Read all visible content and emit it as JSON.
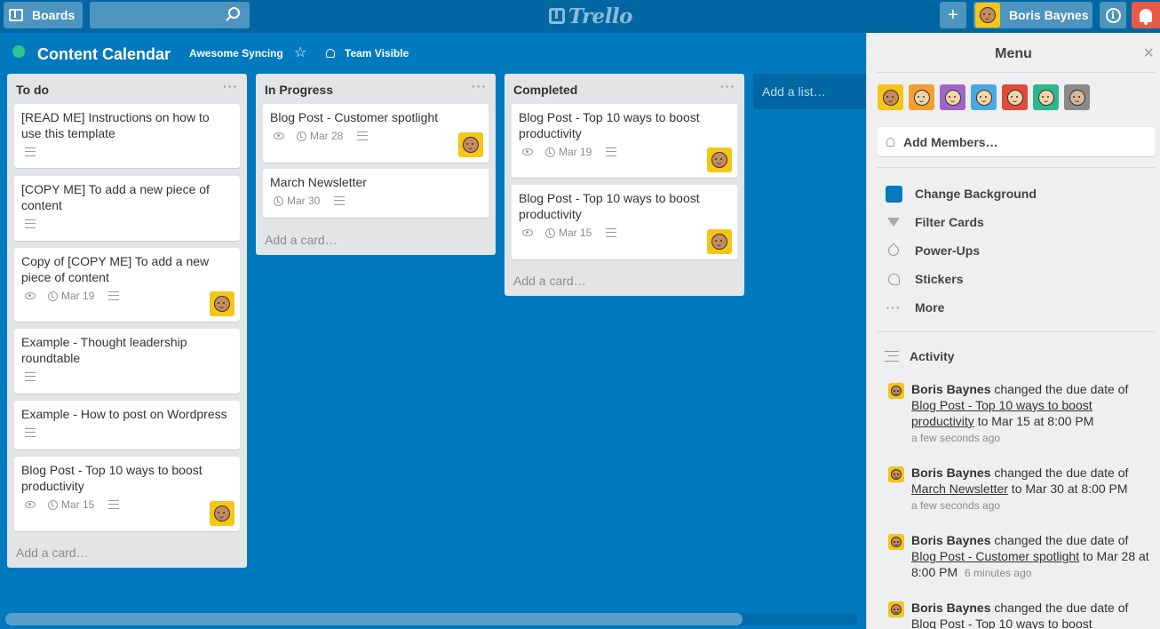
{
  "header": {
    "boards_label": "Boards",
    "search_placeholder": "",
    "logo_text": "Trello",
    "add_label": "+",
    "user_name": "Boris Baynes",
    "info_label": "i"
  },
  "board": {
    "title": "Content Calendar",
    "org": "Awesome Syncing",
    "star": "☆",
    "visibility": "Team Visible"
  },
  "lists": [
    {
      "title": "To do",
      "menu": "···",
      "cards": [
        {
          "title": "[READ ME] Instructions on how to use this template"
        },
        {
          "title": "[COPY ME] To add a new piece of content"
        },
        {
          "title": "Copy of [COPY ME] To add a new piece of content",
          "due": "Mar 19"
        },
        {
          "title": "Example - Thought leadership roundtable"
        },
        {
          "title": "Example - How to post on Wordpress"
        },
        {
          "title": "Blog Post - Top 10 ways to boost productivity",
          "due": "Mar 15"
        }
      ],
      "add_card": "Add a card…"
    },
    {
      "title": "In Progress",
      "menu": "···",
      "cards": [
        {
          "title": "Blog Post - Customer spotlight",
          "due": "Mar 28"
        },
        {
          "title": "March Newsletter",
          "due": "Mar 30"
        }
      ],
      "add_card": "Add a card…"
    },
    {
      "title": "Completed",
      "menu": "···",
      "cards": [
        {
          "title": "Blog Post - Top 10 ways to boost productivity",
          "due": "Mar 19"
        },
        {
          "title": "Blog Post - Top 10 ways to boost productivity",
          "due": "Mar 15"
        }
      ],
      "add_card": "Add a card…"
    }
  ],
  "add_list": "Add a list…",
  "sidebar": {
    "title": "Menu",
    "close": "×",
    "add_members": "Add Members…",
    "menu_items": [
      {
        "label": "Change Background",
        "icon": "background-swatch-icon"
      },
      {
        "label": "Filter Cards",
        "icon": "filter-icon"
      },
      {
        "label": "Power-Ups",
        "icon": "rocket-icon"
      },
      {
        "label": "Stickers",
        "icon": "sticker-icon"
      },
      {
        "label": "More",
        "icon": "more-dots-icon",
        "glyph": "···"
      }
    ],
    "activity_label": "Activity",
    "activity": [
      {
        "who": "Boris Baynes",
        "action": " changed the due date of ",
        "card": "Blog Post - Top 10 ways to boost productivity",
        "rest": " to Mar 15 at 8:00 PM",
        "when": "a few seconds ago"
      },
      {
        "who": "Boris Baynes",
        "action": " changed the due date of ",
        "card": "March Newsletter",
        "rest": " to Mar 30 at 8:00 PM",
        "when": "a few seconds ago"
      },
      {
        "who": "Boris Baynes",
        "action": " changed the due date of ",
        "card": "Blog Post - Customer spotlight",
        "rest": " to Mar 28 at 8:00 PM",
        "when": "6 minutes ago"
      },
      {
        "who": "Boris Baynes",
        "action": " changed the due date of ",
        "card": "Blog Post - Top 10 ways to boost",
        "rest": "",
        "when": ""
      }
    ]
  },
  "colors": {
    "board_bg": "#0079bf",
    "header_bg": "#0067a3",
    "notification": "#eb5a46",
    "avatar_yellow": "#f5c518"
  }
}
